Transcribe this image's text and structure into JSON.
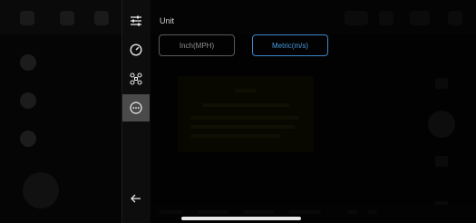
{
  "settings": {
    "section_title": "Unit",
    "options": [
      {
        "label": "Inch(MPH)",
        "selected": false
      },
      {
        "label": "Metric(m/s)",
        "selected": true
      }
    ]
  },
  "sidebar": {
    "items": [
      {
        "icon": "sliders-icon",
        "active": false
      },
      {
        "icon": "gauge-icon",
        "active": false
      },
      {
        "icon": "drone-icon",
        "active": false
      },
      {
        "icon": "more-icon",
        "active": true
      }
    ],
    "back_icon": "back-arrow-icon"
  },
  "colors": {
    "accent": "#3d87c9",
    "active_tab_bg": "#4a4a4a"
  }
}
